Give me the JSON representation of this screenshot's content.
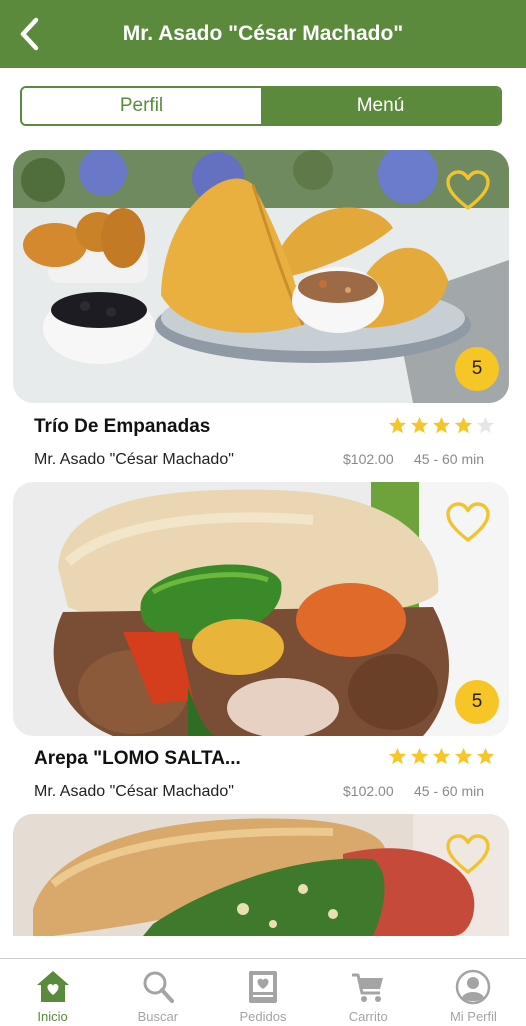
{
  "header": {
    "title": "Mr. Asado \"César Machado\""
  },
  "tabs": [
    {
      "label": "Perfil",
      "active": false
    },
    {
      "label": "Menú",
      "active": true
    }
  ],
  "items": [
    {
      "name": "Trío De Empanadas",
      "restaurant": "Mr. Asado \"César Machado\"",
      "price": "$102.00",
      "time": "45 - 60 min",
      "rating": 4,
      "badge": "5"
    },
    {
      "name": "Arepa \"LOMO SALTA...",
      "restaurant": "Mr. Asado \"César Machado\"",
      "price": "$102.00",
      "time": "45 - 60 min",
      "rating": 5,
      "badge": "5"
    }
  ],
  "nav": [
    {
      "label": "Inicio",
      "icon": "home-icon",
      "active": true
    },
    {
      "label": "Buscar",
      "icon": "search-icon",
      "active": false
    },
    {
      "label": "Pedidos",
      "icon": "receipt-icon",
      "active": false
    },
    {
      "label": "Carrito",
      "icon": "cart-icon",
      "active": false
    },
    {
      "label": "Mi Perfil",
      "icon": "user-icon",
      "active": false
    }
  ],
  "colors": {
    "brand": "#5b8a3c",
    "badge": "#f6c627",
    "star": "#f6c627",
    "star_empty": "#e6e6e6",
    "muted": "#a4a4a4"
  }
}
